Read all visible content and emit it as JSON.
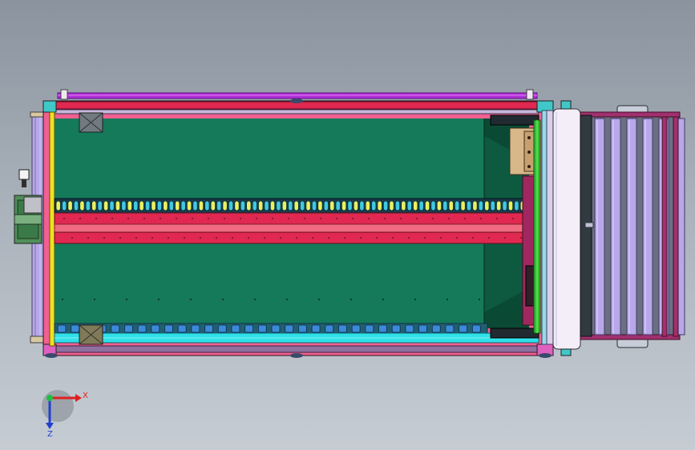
{
  "viewport": {
    "background_top": "#8a939e",
    "background_bottom": "#c6ccd3"
  },
  "model": {
    "colors": {
      "frame_pink": "#e0348a",
      "purple_rail": "#b030d8",
      "green_bed": "#147a5a",
      "dark_green": "#0d5a40",
      "red_beam": "#e02850",
      "pink_beam": "#f06a80",
      "cyan_rail": "#30e0e8",
      "blue_roller": "#3a8ad8",
      "yellow_edge": "#f0e020",
      "lilac_roller": "#b8a8e8",
      "conveyor_frame": "#a03070",
      "cover_white": "#f4eef8",
      "tan_box": "#d8b888",
      "motor_green": "#50905a"
    },
    "chain_link_count": 80,
    "bottom_roller_count": 32,
    "conveyor_roller_count": 6
  },
  "axis_triad": {
    "x_label": "X",
    "z_label": "Z",
    "x_color": "#e02020",
    "z_color": "#2040d0",
    "origin_color": "#20c040"
  }
}
